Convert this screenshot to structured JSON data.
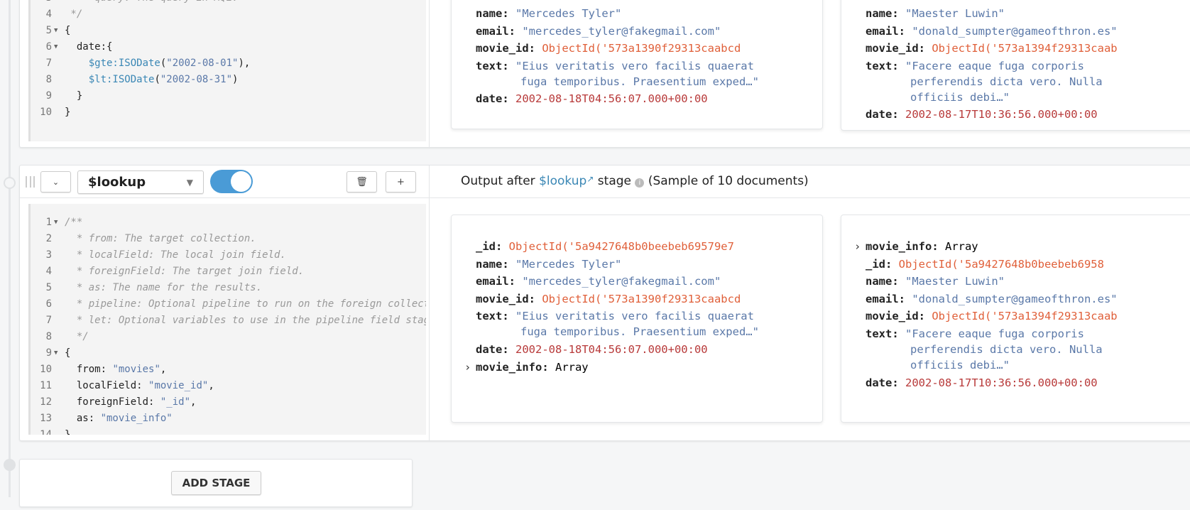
{
  "match_stage": {
    "editor_lines": [
      {
        "n": "3",
        "parts": [
          [
            "cm",
            "   * query: The query in MQL."
          ]
        ]
      },
      {
        "n": "4",
        "parts": [
          [
            "cm",
            " */"
          ]
        ]
      },
      {
        "n": "5",
        "fold": true,
        "parts": [
          [
            "",
            "{"
          ]
        ]
      },
      {
        "n": "6",
        "fold": true,
        "parts": [
          [
            "",
            "  date:{"
          ]
        ]
      },
      {
        "n": "7",
        "parts": [
          [
            "kw",
            "    $gte:ISODate"
          ],
          [
            "",
            "("
          ],
          [
            "st",
            "\"2002-08-01\""
          ],
          [
            "",
            "),"
          ]
        ]
      },
      {
        "n": "8",
        "parts": [
          [
            "kw",
            "    $lt:ISODate"
          ],
          [
            "",
            "("
          ],
          [
            "st",
            "\"2002-08-31\""
          ],
          [
            "",
            ")"
          ]
        ]
      },
      {
        "n": "9",
        "parts": [
          [
            "",
            "  }"
          ]
        ]
      },
      {
        "n": "10",
        "parts": [
          [
            "",
            "}"
          ]
        ]
      }
    ],
    "documents": [
      {
        "fields": [
          [
            "name",
            "\"Mercedes Tyler\"",
            "str"
          ],
          [
            "email",
            "\"mercedes_tyler@fakegmail.com\"",
            "str"
          ],
          [
            "movie_id",
            "ObjectId('573a1390f29313caabcd",
            "oid"
          ],
          [
            "text",
            "\"Eius veritatis vero facilis quaerat|fuga temporibus. Praesentium exped…\"",
            "str"
          ],
          [
            "date",
            "2002-08-18T04:56:07.000+00:00",
            "date"
          ]
        ]
      },
      {
        "fields": [
          [
            "name",
            "\"Maester Luwin\"",
            "str"
          ],
          [
            "email",
            "\"donald_sumpter@gameofthron.es\"",
            "str"
          ],
          [
            "movie_id",
            "ObjectId('573a1394f29313caab",
            "oid"
          ],
          [
            "text",
            "\"Facere eaque fuga corporis|perferendis dicta vero. Nulla|officiis debi…\"",
            "str"
          ],
          [
            "date",
            "2002-08-17T10:36:56.000+00:00",
            "date"
          ]
        ]
      }
    ]
  },
  "lookup_stage": {
    "operator": "$lookup",
    "enabled": true,
    "output_prefix": "Output after",
    "output_operator": "$lookup",
    "output_suffix": "stage",
    "sample_text": "(Sample of 10 documents)",
    "editor_lines": [
      {
        "n": "1",
        "fold": true,
        "parts": [
          [
            "cm",
            "/**"
          ]
        ]
      },
      {
        "n": "2",
        "parts": [
          [
            "cm",
            "  * from: The target collection."
          ]
        ]
      },
      {
        "n": "3",
        "parts": [
          [
            "cm",
            "  * localField: The local join field."
          ]
        ]
      },
      {
        "n": "4",
        "parts": [
          [
            "cm",
            "  * foreignField: The target join field."
          ]
        ]
      },
      {
        "n": "5",
        "parts": [
          [
            "cm",
            "  * as: The name for the results."
          ]
        ]
      },
      {
        "n": "6",
        "parts": [
          [
            "cm",
            "  * pipeline: Optional pipeline to run on the foreign collection."
          ]
        ]
      },
      {
        "n": "7",
        "parts": [
          [
            "cm",
            "  * let: Optional variables to use in the pipeline field stages."
          ]
        ]
      },
      {
        "n": "8",
        "parts": [
          [
            "cm",
            "  */"
          ]
        ]
      },
      {
        "n": "9",
        "fold": true,
        "parts": [
          [
            "",
            "{"
          ]
        ]
      },
      {
        "n": "10",
        "parts": [
          [
            "",
            "  from: "
          ],
          [
            "st",
            "\"movies\""
          ],
          [
            "",
            ","
          ]
        ]
      },
      {
        "n": "11",
        "parts": [
          [
            "",
            "  localField: "
          ],
          [
            "st",
            "\"movie_id\""
          ],
          [
            "",
            ","
          ]
        ]
      },
      {
        "n": "12",
        "parts": [
          [
            "",
            "  foreignField: "
          ],
          [
            "st",
            "\"_id\""
          ],
          [
            "",
            ","
          ]
        ]
      },
      {
        "n": "13",
        "parts": [
          [
            "",
            "  as: "
          ],
          [
            "st",
            "\"movie_info\""
          ]
        ]
      },
      {
        "n": "14",
        "parts": [
          [
            "",
            "}"
          ]
        ]
      }
    ],
    "documents": [
      {
        "fields": [
          [
            "_id",
            "ObjectId('5a9427648b0beebeb69579e7",
            "oid"
          ],
          [
            "name",
            "\"Mercedes Tyler\"",
            "str"
          ],
          [
            "email",
            "\"mercedes_tyler@fakegmail.com\"",
            "str"
          ],
          [
            "movie_id",
            "ObjectId('573a1390f29313caabcd",
            "oid"
          ],
          [
            "text",
            "\"Eius veritatis vero facilis quaerat|fuga temporibus. Praesentium exped…\"",
            "str"
          ],
          [
            "date",
            "2002-08-18T04:56:07.000+00:00",
            "date"
          ],
          [
            "movie_info",
            "Array",
            "arr"
          ]
        ]
      },
      {
        "fields": [
          [
            "movie_info",
            "Array",
            "arr"
          ],
          [
            "_id",
            "ObjectId('5a9427648b0beebeb6958",
            "oid"
          ],
          [
            "name",
            "\"Maester Luwin\"",
            "str"
          ],
          [
            "email",
            "\"donald_sumpter@gameofthron.es\"",
            "str"
          ],
          [
            "movie_id",
            "ObjectId('573a1394f29313caab",
            "oid"
          ],
          [
            "text",
            "\"Facere eaque fuga corporis|perferendis dicta vero. Nulla|officiis debi…\"",
            "str"
          ],
          [
            "date",
            "2002-08-17T10:36:56.000+00:00",
            "date"
          ]
        ]
      }
    ]
  },
  "add_stage_label": "ADD STAGE",
  "colors": {
    "toggle": "#4a9bd6",
    "link": "#3a87b5",
    "objectid": "#e0603a",
    "date": "#b83a3a",
    "string": "#5a78a8"
  }
}
